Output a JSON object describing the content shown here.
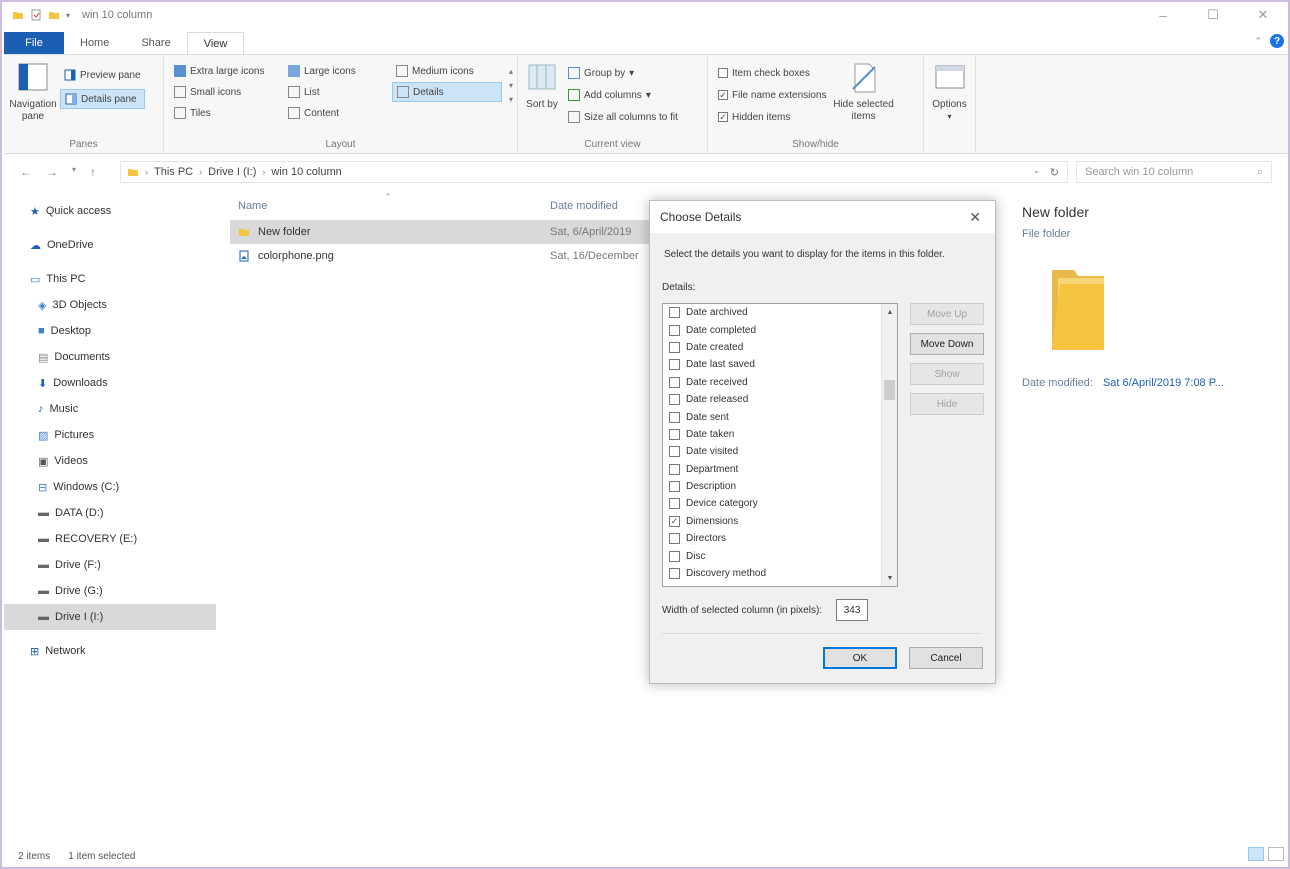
{
  "window": {
    "title": "win 10 column"
  },
  "ribbon_tabs": [
    "File",
    "Home",
    "Share",
    "View"
  ],
  "ribbon": {
    "panes": {
      "navigation_pane": "Navigation pane",
      "preview_pane": "Preview pane",
      "details_pane": "Details pane",
      "label": "Panes"
    },
    "layout": {
      "items": [
        "Extra large icons",
        "Large icons",
        "Medium icons",
        "Small icons",
        "List",
        "Details",
        "Tiles",
        "Content"
      ],
      "label": "Layout"
    },
    "current_view": {
      "sort_by": "Sort by",
      "group_by": "Group by",
      "add_columns": "Add columns",
      "size_all": "Size all columns to fit",
      "label": "Current view"
    },
    "show_hide": {
      "item_check_boxes": "Item check boxes",
      "file_name_extensions": "File name extensions",
      "hidden_items": "Hidden items",
      "hide_selected": "Hide selected items",
      "label": "Show/hide"
    },
    "options": "Options"
  },
  "address": {
    "crumbs": [
      "This PC",
      "Drive I (I:)",
      "win 10 column"
    ],
    "search_placeholder": "Search win 10 column"
  },
  "nav": {
    "quick_access": "Quick access",
    "onedrive": "OneDrive",
    "this_pc": "This PC",
    "pc_items": [
      "3D Objects",
      "Desktop",
      "Documents",
      "Downloads",
      "Music",
      "Pictures",
      "Videos",
      "Windows (C:)",
      "DATA (D:)",
      "RECOVERY (E:)",
      "Drive (F:)",
      "Drive (G:)",
      "Drive I (I:)"
    ],
    "network": "Network"
  },
  "filelist": {
    "col_name": "Name",
    "col_date": "Date modified",
    "rows": [
      {
        "name": "New folder",
        "date": "Sat, 6/April/2019"
      },
      {
        "name": "colorphone.png",
        "date": "Sat, 16/December"
      }
    ]
  },
  "preview": {
    "title": "New folder",
    "type": "File folder",
    "date_label": "Date modified:",
    "date_value": "Sat 6/April/2019 7:08 P..."
  },
  "status": {
    "count": "2 items",
    "selected": "1 item selected"
  },
  "dialog": {
    "title": "Choose Details",
    "description": "Select the details you want to display for the items in this folder.",
    "details_label": "Details:",
    "items": [
      {
        "label": "Date archived",
        "checked": false
      },
      {
        "label": "Date completed",
        "checked": false
      },
      {
        "label": "Date created",
        "checked": false
      },
      {
        "label": "Date last saved",
        "checked": false
      },
      {
        "label": "Date received",
        "checked": false
      },
      {
        "label": "Date released",
        "checked": false
      },
      {
        "label": "Date sent",
        "checked": false
      },
      {
        "label": "Date taken",
        "checked": false
      },
      {
        "label": "Date visited",
        "checked": false
      },
      {
        "label": "Department",
        "checked": false
      },
      {
        "label": "Description",
        "checked": false
      },
      {
        "label": "Device category",
        "checked": false
      },
      {
        "label": "Dimensions",
        "checked": true
      },
      {
        "label": "Directors",
        "checked": false
      },
      {
        "label": "Disc",
        "checked": false
      },
      {
        "label": "Discovery method",
        "checked": false
      }
    ],
    "buttons": {
      "move_up": "Move Up",
      "move_down": "Move Down",
      "show": "Show",
      "hide": "Hide",
      "ok": "OK",
      "cancel": "Cancel"
    },
    "width_label": "Width of selected column (in pixels):",
    "width_value": "343"
  },
  "colors": {
    "accent": "#1a5fb4",
    "selection": "#cce4f7",
    "folder": "#f5c542"
  }
}
